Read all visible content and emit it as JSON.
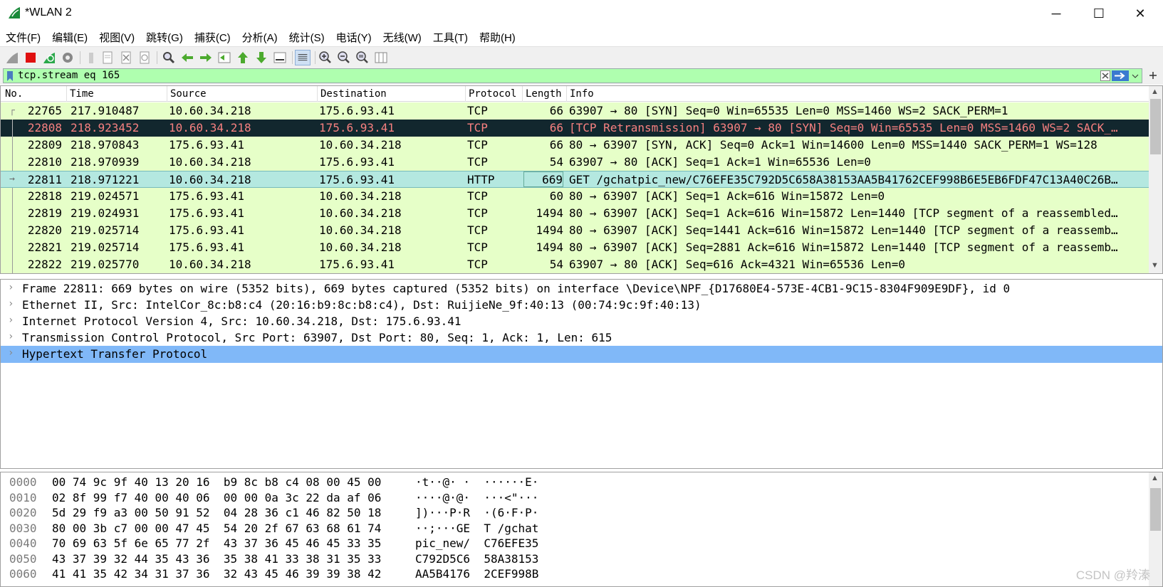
{
  "window": {
    "title": "*WLAN 2",
    "minimize": "─",
    "maximize": "☐",
    "close": "✕"
  },
  "menu": [
    "文件(F)",
    "编辑(E)",
    "视图(V)",
    "跳转(G)",
    "捕获(C)",
    "分析(A)",
    "统计(S)",
    "电话(Y)",
    "无线(W)",
    "工具(T)",
    "帮助(H)"
  ],
  "filter": {
    "value": "tcp.stream eq 165"
  },
  "packet_list": {
    "columns": [
      "No.",
      "Time",
      "Source",
      "Destination",
      "Protocol",
      "Length",
      "Info"
    ],
    "rows": [
      {
        "no": "22765",
        "time": "217.910487",
        "src": "10.60.34.218",
        "dst": "175.6.93.41",
        "proto": "TCP",
        "len": "66",
        "info": "63907 → 80 [SYN] Seq=0 Win=65535 Len=0 MSS=1460 WS=2 SACK_PERM=1",
        "style": "tcp"
      },
      {
        "no": "22808",
        "time": "218.923452",
        "src": "10.60.34.218",
        "dst": "175.6.93.41",
        "proto": "TCP",
        "len": "66",
        "info": "[TCP Retransmission] 63907 → 80 [SYN] Seq=0 Win=65535 Len=0 MSS=1460 WS=2 SACK_…",
        "style": "sel"
      },
      {
        "no": "22809",
        "time": "218.970843",
        "src": "175.6.93.41",
        "dst": "10.60.34.218",
        "proto": "TCP",
        "len": "66",
        "info": "80 → 63907 [SYN, ACK] Seq=0 Ack=1 Win=14600 Len=0 MSS=1440 SACK_PERM=1 WS=128",
        "style": "tcp"
      },
      {
        "no": "22810",
        "time": "218.970939",
        "src": "10.60.34.218",
        "dst": "175.6.93.41",
        "proto": "TCP",
        "len": "54",
        "info": "63907 → 80 [ACK] Seq=1 Ack=1 Win=65536 Len=0",
        "style": "tcp"
      },
      {
        "no": "22811",
        "time": "218.971221",
        "src": "10.60.34.218",
        "dst": "175.6.93.41",
        "proto": "HTTP",
        "len": "669",
        "info": "GET /gchatpic_new/C76EFE35C792D5C658A38153AA5B41762CEF998B6E5EB6FDF47C13A40C26B…",
        "style": "http"
      },
      {
        "no": "22818",
        "time": "219.024571",
        "src": "175.6.93.41",
        "dst": "10.60.34.218",
        "proto": "TCP",
        "len": "60",
        "info": "80 → 63907 [ACK] Seq=1 Ack=616 Win=15872 Len=0",
        "style": "tcp"
      },
      {
        "no": "22819",
        "time": "219.024931",
        "src": "175.6.93.41",
        "dst": "10.60.34.218",
        "proto": "TCP",
        "len": "1494",
        "info": "80 → 63907 [ACK] Seq=1 Ack=616 Win=15872 Len=1440 [TCP segment of a reassembled…",
        "style": "tcp"
      },
      {
        "no": "22820",
        "time": "219.025714",
        "src": "175.6.93.41",
        "dst": "10.60.34.218",
        "proto": "TCP",
        "len": "1494",
        "info": "80 → 63907 [ACK] Seq=1441 Ack=616 Win=15872 Len=1440 [TCP segment of a reassemb…",
        "style": "tcp"
      },
      {
        "no": "22821",
        "time": "219.025714",
        "src": "175.6.93.41",
        "dst": "10.60.34.218",
        "proto": "TCP",
        "len": "1494",
        "info": "80 → 63907 [ACK] Seq=2881 Ack=616 Win=15872 Len=1440 [TCP segment of a reassemb…",
        "style": "tcp"
      },
      {
        "no": "22822",
        "time": "219.025770",
        "src": "10.60.34.218",
        "dst": "175.6.93.41",
        "proto": "TCP",
        "len": "54",
        "info": "63907 → 80 [ACK] Seq=616 Ack=4321 Win=65536 Len=0",
        "style": "tcp"
      }
    ]
  },
  "details": {
    "rows": [
      {
        "text": "Frame 22811: 669 bytes on wire (5352 bits), 669 bytes captured (5352 bits) on interface \\Device\\NPF_{D17680E4-573E-4CB1-9C15-8304F909E9DF}, id 0",
        "selected": false
      },
      {
        "text": "Ethernet II, Src: IntelCor_8c:b8:c4 (20:16:b9:8c:b8:c4), Dst: RuijieNe_9f:40:13 (00:74:9c:9f:40:13)",
        "selected": false
      },
      {
        "text": "Internet Protocol Version 4, Src: 10.60.34.218, Dst: 175.6.93.41",
        "selected": false
      },
      {
        "text": "Transmission Control Protocol, Src Port: 63907, Dst Port: 80, Seq: 1, Ack: 1, Len: 615",
        "selected": false
      },
      {
        "text": "Hypertext Transfer Protocol",
        "selected": true
      }
    ],
    "expander": "›"
  },
  "bytes": {
    "rows": [
      {
        "offset": "0000",
        "hex": "00 74 9c 9f 40 13 20 16  b9 8c b8 c4 08 00 45 00",
        "ascii": "·t··@· ·  ······E·"
      },
      {
        "offset": "0010",
        "hex": "02 8f 99 f7 40 00 40 06  00 00 0a 3c 22 da af 06",
        "ascii": "····@·@·  ···<\"···"
      },
      {
        "offset": "0020",
        "hex": "5d 29 f9 a3 00 50 91 52  04 28 36 c1 46 82 50 18",
        "ascii": "])···P·R  ·(6·F·P·"
      },
      {
        "offset": "0030",
        "hex": "80 00 3b c7 00 00 47 45  54 20 2f 67 63 68 61 74",
        "ascii": "··;···GE  T /gchat"
      },
      {
        "offset": "0040",
        "hex": "70 69 63 5f 6e 65 77 2f  43 37 36 45 46 45 33 35",
        "ascii": "pic_new/  C76EFE35"
      },
      {
        "offset": "0050",
        "hex": "43 37 39 32 44 35 43 36  35 38 41 33 38 31 35 33",
        "ascii": "C792D5C6  58A38153"
      },
      {
        "offset": "0060",
        "hex": "41 41 35 42 34 31 37 36  32 43 45 46 39 39 38 42",
        "ascii": "AA5B4176  2CEF998B"
      }
    ]
  },
  "watermark": "CSDN @羚溱",
  "colors": {
    "tcp_row": "#e6ffc8",
    "selected_row_bg": "#12272e",
    "selected_row_fg": "#f78080",
    "http_row": "#b4e8e0",
    "filter_bg": "#afffaf",
    "detail_selected": "#80b8f8"
  }
}
